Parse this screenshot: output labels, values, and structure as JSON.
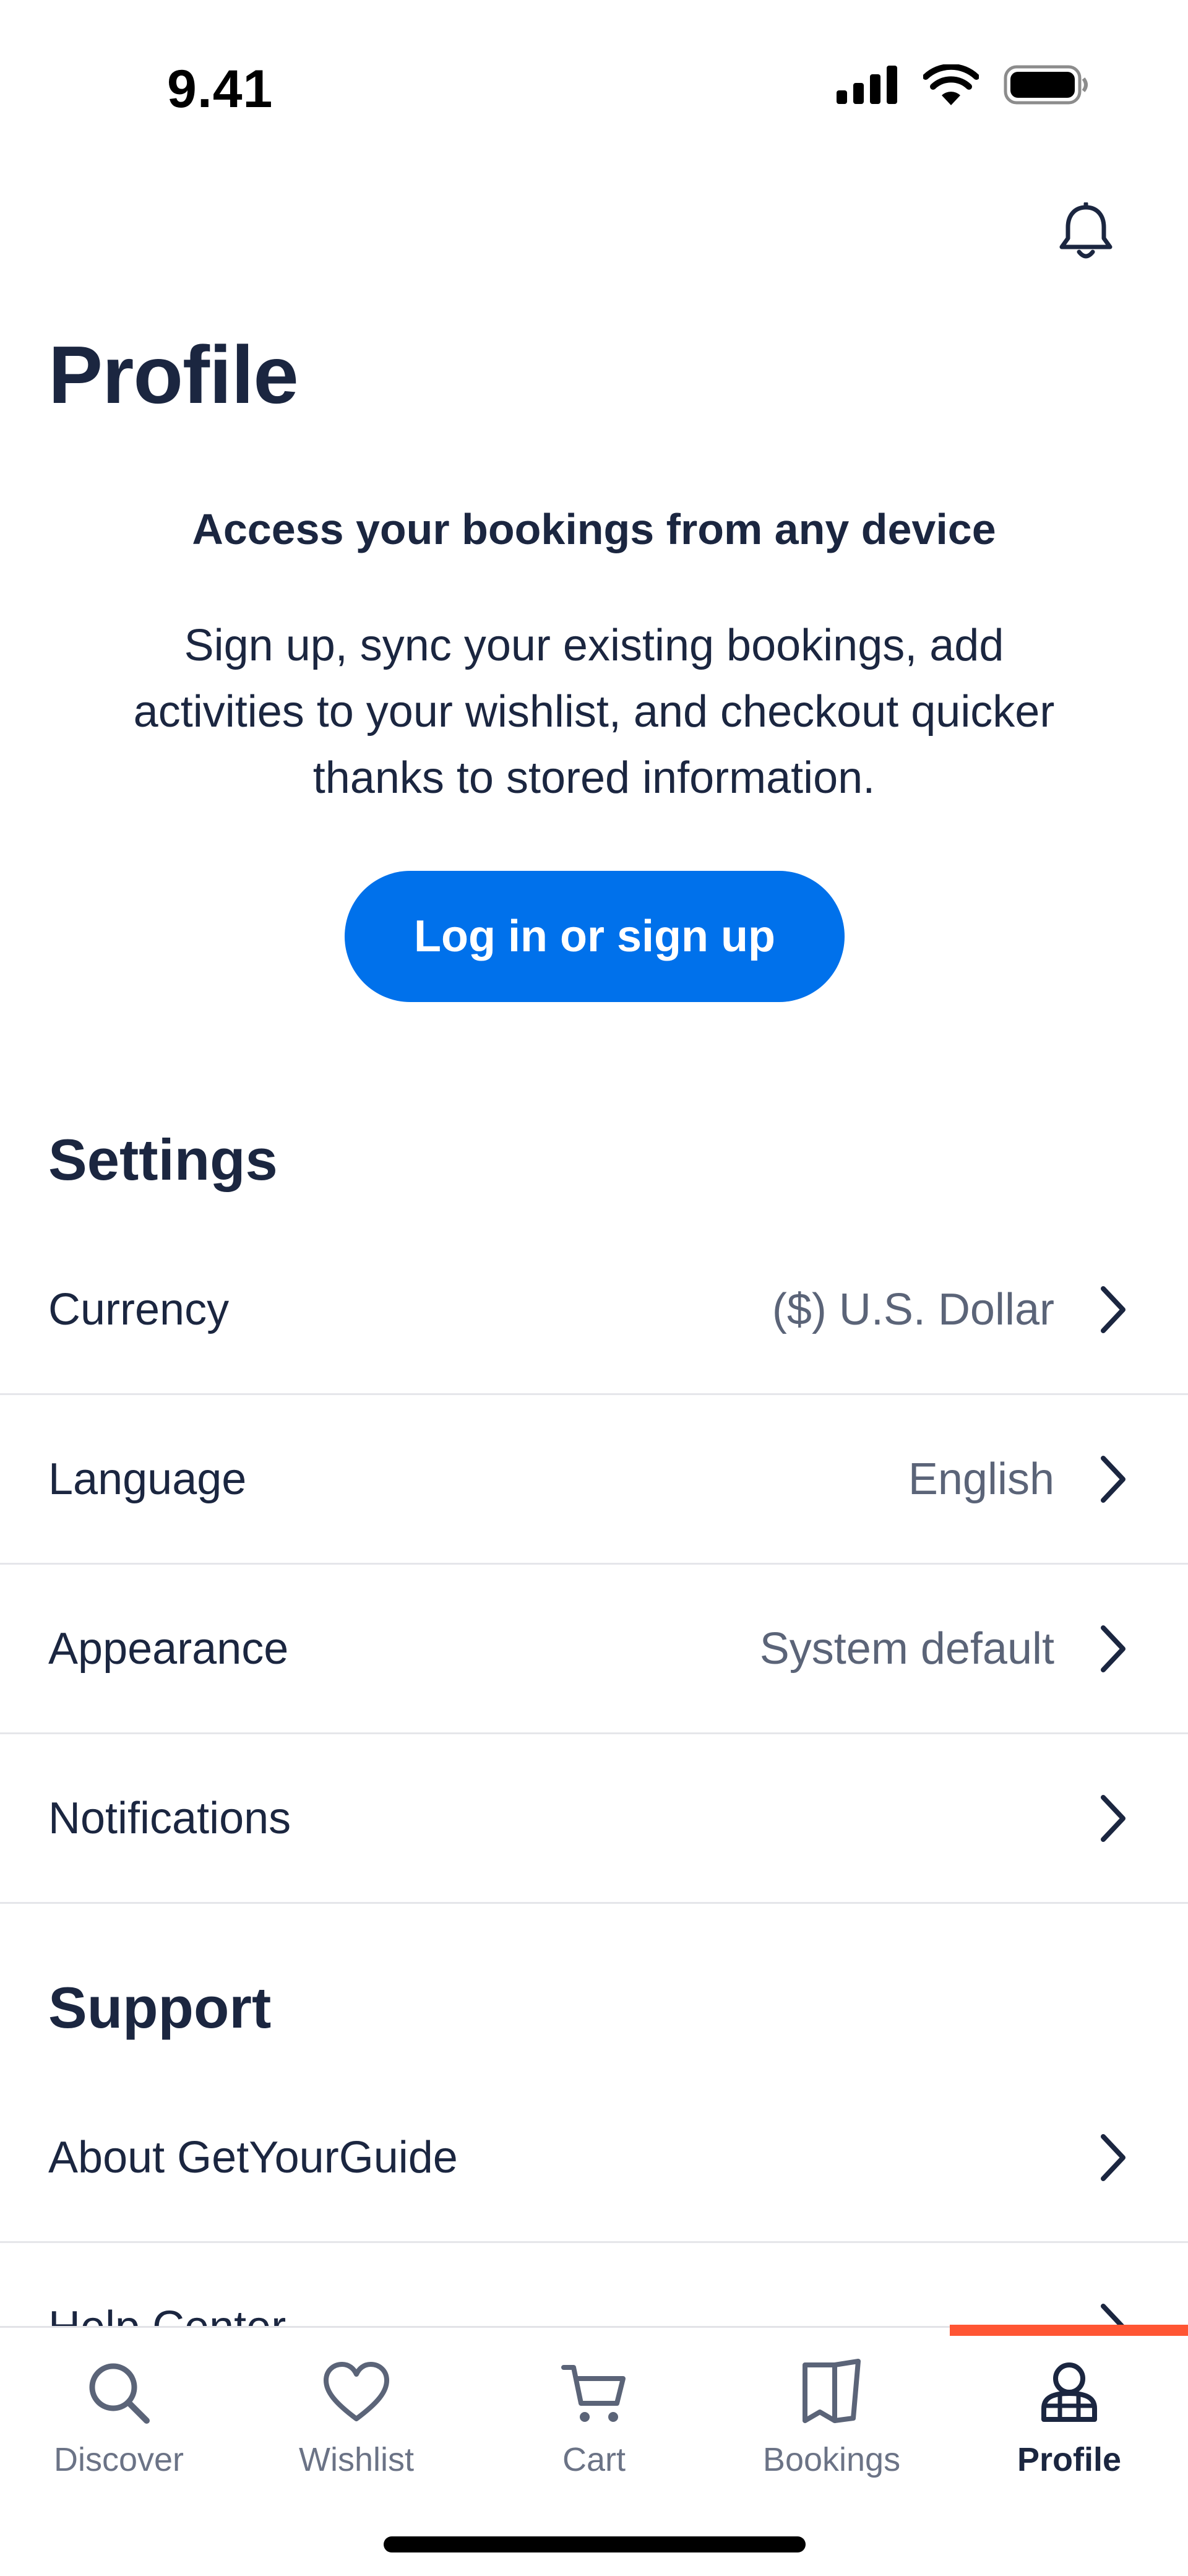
{
  "status_bar": {
    "time": "9.41"
  },
  "header": {
    "title": "Profile",
    "notification_icon": "bell-icon"
  },
  "promo": {
    "heading": "Access your bookings from any device",
    "body": "Sign up, sync your existing bookings, add activities to your wishlist, and checkout quicker thanks to stored information.",
    "button_label": "Log in or sign up"
  },
  "settings": {
    "title": "Settings",
    "items": [
      {
        "label": "Currency",
        "value": "($) U.S. Dollar"
      },
      {
        "label": "Language",
        "value": "English"
      },
      {
        "label": "Appearance",
        "value": "System default"
      },
      {
        "label": "Notifications",
        "value": ""
      }
    ]
  },
  "support": {
    "title": "Support",
    "items": [
      {
        "label": "About GetYourGuide"
      },
      {
        "label": "Help Center"
      }
    ]
  },
  "tab_bar": {
    "tabs": [
      {
        "label": "Discover",
        "icon": "search-icon"
      },
      {
        "label": "Wishlist",
        "icon": "heart-icon"
      },
      {
        "label": "Cart",
        "icon": "cart-icon"
      },
      {
        "label": "Bookings",
        "icon": "ticket-icon"
      },
      {
        "label": "Profile",
        "icon": "profile-icon"
      }
    ],
    "active": "Profile",
    "accent_color": "#ff5533"
  },
  "colors": {
    "primary_button": "#0071eb",
    "text_primary": "#1b2640",
    "text_secondary": "#5b6478"
  }
}
